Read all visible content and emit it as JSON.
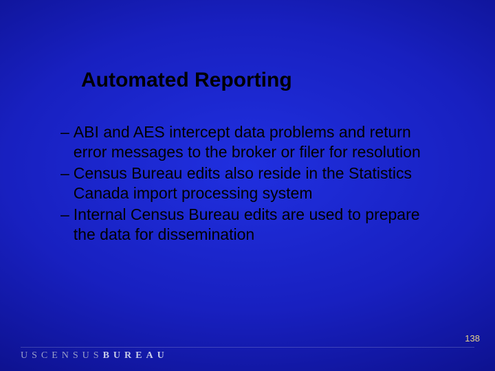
{
  "slide": {
    "title": "Automated Reporting",
    "bullets": [
      "ABI and AES intercept data problems and return error messages to the broker or filer for resolution",
      "Census Bureau edits also reside in the Statistics Canada import processing system",
      "Internal Census Bureau edits are used to prepare the data for dissemination"
    ],
    "page_number": "138",
    "footer_org_1": "USCENSUS",
    "footer_org_2": "BUREAU"
  }
}
